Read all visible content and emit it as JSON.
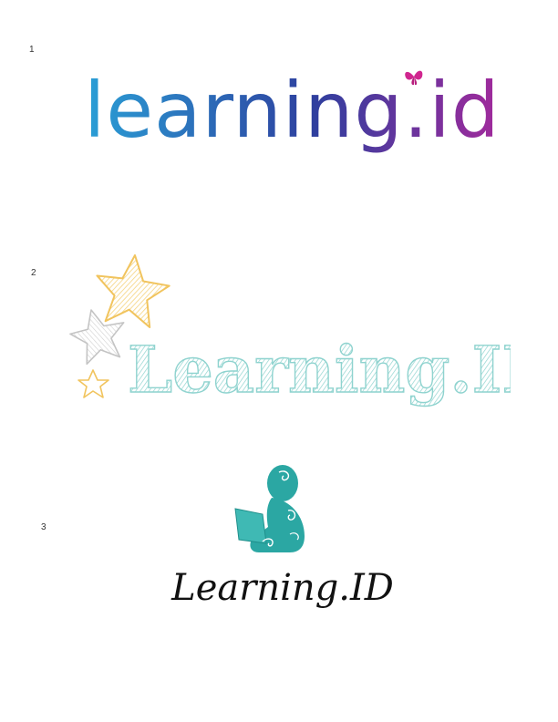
{
  "options": [
    {
      "number": "1",
      "wordmark": "learning.id"
    },
    {
      "number": "2",
      "wordmark": "Learning.ID"
    },
    {
      "number": "3",
      "wordmark": "Learning.ID"
    }
  ],
  "colors": {
    "gradient_start": "#2a9fd6",
    "gradient_mid": "#2e3f9e",
    "gradient_end": "#a22a9c",
    "butterfly": "#d0268f",
    "sketch_teal": "#8fd3cf",
    "star_yellow": "#f5d37e",
    "star_gray": "#cfcfcf",
    "figure_teal": "#2ba7a3",
    "black_text": "#111111"
  },
  "icons": [
    "butterfly-icon",
    "star-icon",
    "reading-figure-icon"
  ]
}
